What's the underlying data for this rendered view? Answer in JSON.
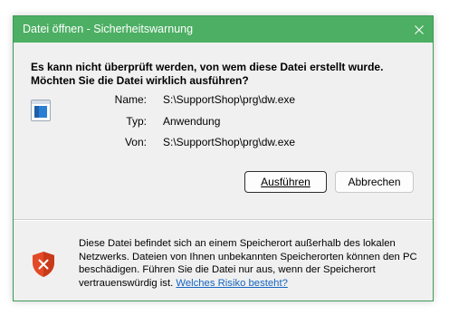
{
  "dialog": {
    "title": "Datei öffnen - Sicherheitswarnung",
    "headline": "Es kann nicht überprüft werden, von wem diese Datei erstellt wurde. Möchten Sie die Datei wirklich ausführen?",
    "details": [
      {
        "label": "Name:",
        "value": "S:\\SupportShop\\prg\\dw.exe"
      },
      {
        "label": "Typ:",
        "value": "Anwendung"
      },
      {
        "label": "Von:",
        "value": "S:\\SupportShop\\prg\\dw.exe"
      }
    ],
    "buttons": {
      "run": "Ausführen",
      "cancel": "Abbrechen"
    },
    "warning_text": "Diese Datei befindet sich an einem Speicherort außerhalb des lokalen Netzwerks. Dateien von Ihnen unbekannten Speicherorten können den PC beschädigen. Führen Sie die Datei nur aus, wenn der Speicherort vertrauenswürdig ist.",
    "warning_link": "Welches Risiko besteht?",
    "icons": {
      "close": "close-icon",
      "file": "application-file-icon",
      "shield": "warning-shield-icon"
    },
    "colors": {
      "titlebar": "#4caf63",
      "border": "#3d9b57",
      "shield": "#e24a27",
      "link": "#1565c0"
    }
  }
}
